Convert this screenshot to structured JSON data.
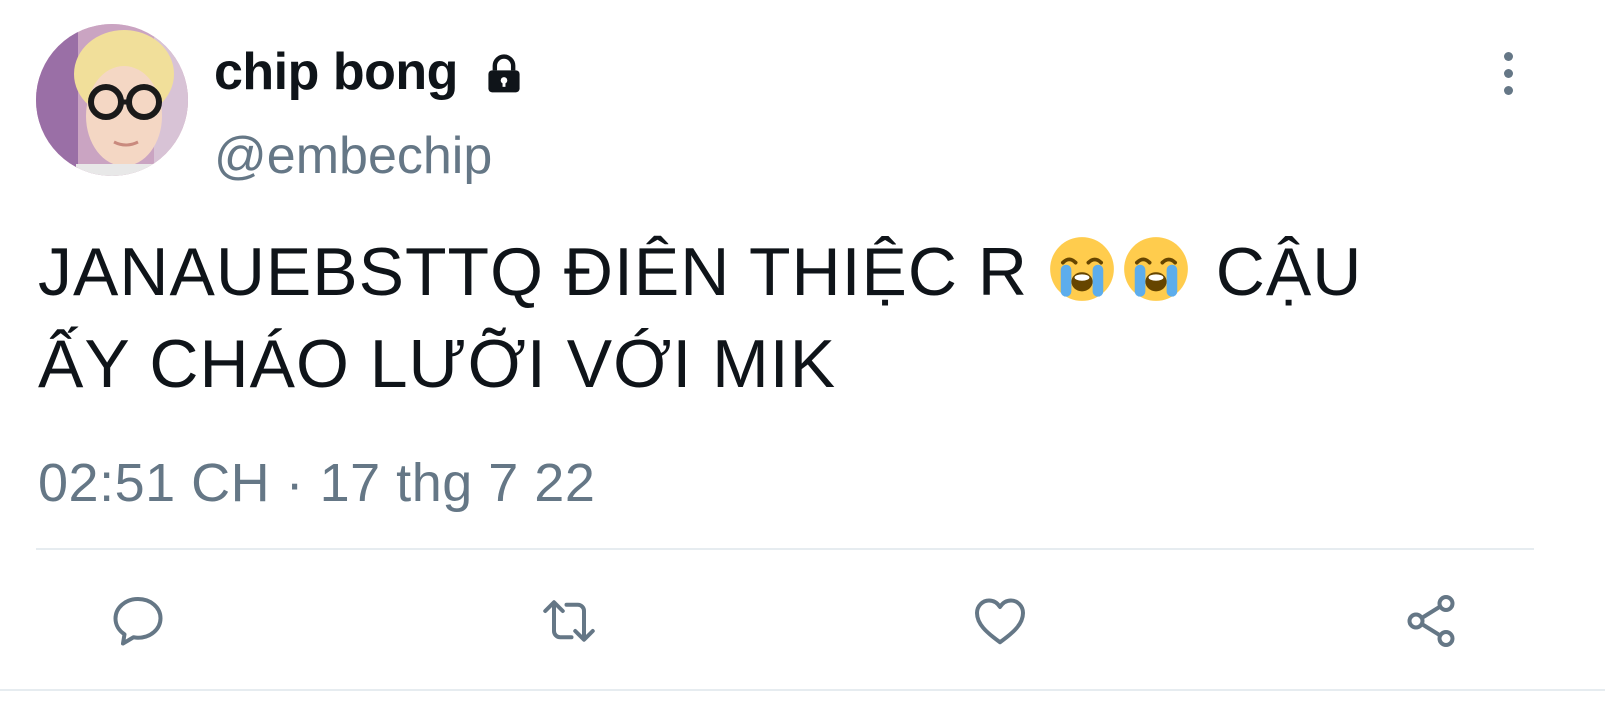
{
  "tweet": {
    "author": {
      "display_name": "chip bong",
      "handle": "@embechip",
      "protected": true,
      "avatar_icon": "profile-photo"
    },
    "text": {
      "line1_before": "JANAUEBSTTQ ĐIÊN THIỆC R ",
      "emoji": "😭😭",
      "emoji_icon": "loudly-crying-face",
      "line1_after": " CẬU",
      "line2": "ẤY CHÁO LƯỠI VỚI MIK"
    },
    "timestamp": "02:51 CH · 17 thg 7 22",
    "actions": {
      "reply_icon": "reply-icon",
      "retweet_icon": "retweet-icon",
      "like_icon": "heart-icon",
      "share_icon": "share-icon"
    },
    "colors": {
      "text_primary": "#0f1419",
      "text_secondary": "#657786",
      "divider": "#e6ecf0",
      "background": "#ffffff"
    }
  }
}
